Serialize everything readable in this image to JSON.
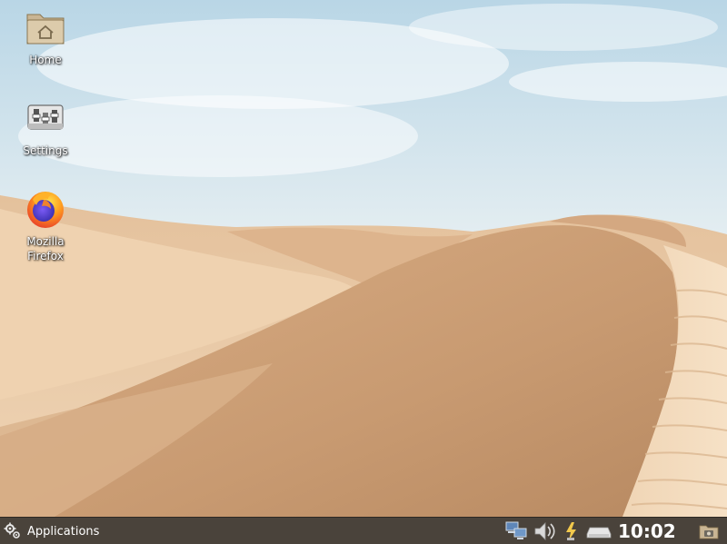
{
  "desktop": {
    "icons": [
      {
        "label": "Home",
        "icon": "home-folder-icon"
      },
      {
        "label": "Settings",
        "icon": "settings-icon"
      },
      {
        "label": "Mozilla\nFirefox",
        "icon": "firefox-icon"
      }
    ]
  },
  "panel": {
    "applications_label": "Applications",
    "clock": "10:02",
    "tray_icons": [
      "network-icon",
      "volume-icon",
      "power-icon",
      "removable-drive-icon",
      "screenshot-folder-icon"
    ]
  },
  "colors": {
    "panel_bg": "#4a433b",
    "sand_light": "#e8c7a2",
    "sand_dark": "#c99a70",
    "sky": "#cfe0ea"
  }
}
